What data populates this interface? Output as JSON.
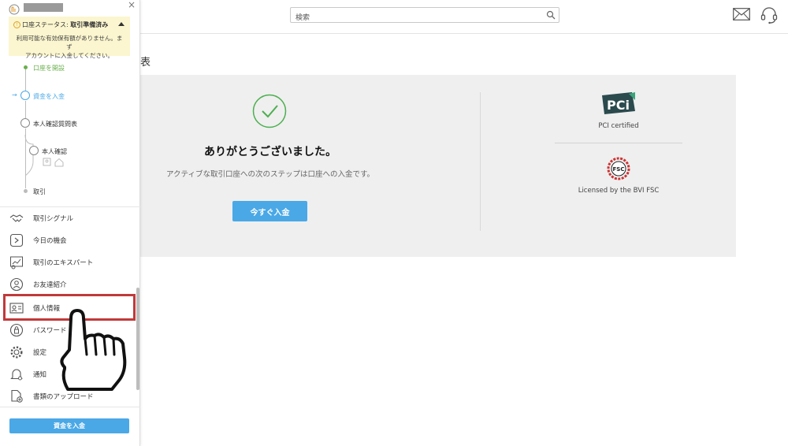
{
  "header": {
    "search_placeholder": "検索",
    "icons": [
      "search-icon",
      "mail-icon",
      "headset-icon"
    ]
  },
  "page": {
    "heading_fragment": "表"
  },
  "card": {
    "thanks_title": "ありがとうございました。",
    "next_step_text": "アクティブな取引口座への次のステップは口座への入金です。",
    "deposit_now_label": "今すぐ入金",
    "pci_label": "PCI certified",
    "fsc_label": "Licensed by the BVI FSC",
    "pci_logo_text": "PCi",
    "fsc_logo_text": "FSC"
  },
  "sidebar": {
    "status_prefix": "口座ステータス: ",
    "status_value": "取引準備済み",
    "status_message_1": "利用可能な有効保有額がありません。まず",
    "status_message_2": "アカウントに入金してください。",
    "steps": [
      {
        "label": "口座を開設",
        "state": "done"
      },
      {
        "label": "資金を入金",
        "state": "current"
      },
      {
        "label": "本人確認質問表",
        "state": "pending"
      },
      {
        "label": "本人確認",
        "state": "pending"
      },
      {
        "label": "取引",
        "state": "pending"
      }
    ],
    "menu": [
      {
        "label": "取引シグナル",
        "icon": "handshake-icon"
      },
      {
        "label": "今日の機会",
        "icon": "play-icon"
      },
      {
        "label": "取引のエキスパート",
        "icon": "expert-chart-icon"
      },
      {
        "label": "お友達紹介",
        "icon": "refer-friend-icon"
      },
      {
        "label": "個人情報",
        "icon": "id-card-icon"
      },
      {
        "label": "パスワード",
        "icon": "lock-icon"
      },
      {
        "label": "設定",
        "icon": "gear-icon"
      },
      {
        "label": "通知",
        "icon": "bell-icon"
      },
      {
        "label": "書類のアップロード",
        "icon": "document-upload-icon"
      }
    ],
    "deposit_button_label": "資金を入金"
  },
  "colors": {
    "accent_blue": "#4aa8e6",
    "success_green": "#4caf50",
    "status_bg": "#fbf6cf",
    "highlight_red": "#c0393b",
    "card_bg": "#efefef"
  }
}
